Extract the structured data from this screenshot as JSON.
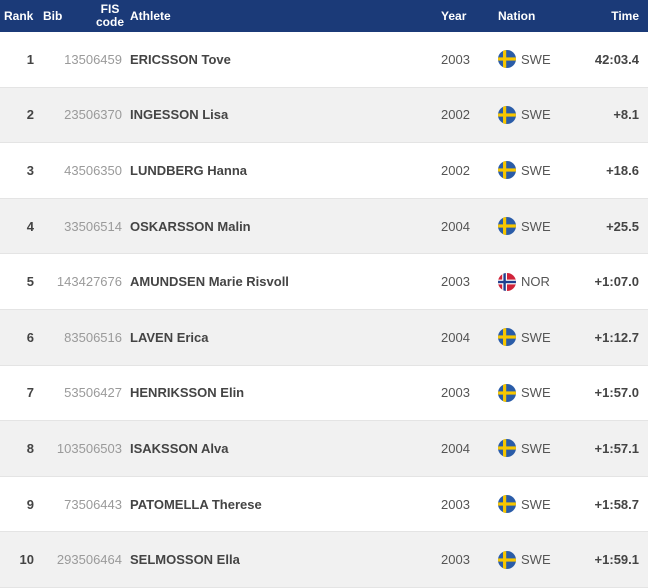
{
  "header": {
    "rank": "Rank",
    "bib": "Bib",
    "fis_line1": "FIS",
    "fis_line2": "code",
    "athlete": "Athlete",
    "year": "Year",
    "nation": "Nation",
    "time": "Time"
  },
  "colors": {
    "header_bg": "#1b3a78",
    "alt_row_bg": "#f1f1f1",
    "swe_blue": "#2a5ca8",
    "swe_yellow": "#f7c600",
    "nor_red": "#d0233a",
    "nor_blue": "#1f3f8f"
  },
  "rows": [
    {
      "rank": "1",
      "bib": "1",
      "fis": "3506459",
      "athlete": "ERICSSON Tove",
      "year": "2003",
      "flag": "swe-flag-icon",
      "nation": "SWE",
      "time": "42:03.4"
    },
    {
      "rank": "2",
      "bib": "2",
      "fis": "3506370",
      "athlete": "INGESSON Lisa",
      "year": "2002",
      "flag": "swe-flag-icon",
      "nation": "SWE",
      "time": "+8.1"
    },
    {
      "rank": "3",
      "bib": "4",
      "fis": "3506350",
      "athlete": "LUNDBERG Hanna",
      "year": "2002",
      "flag": "swe-flag-icon",
      "nation": "SWE",
      "time": "+18.6"
    },
    {
      "rank": "4",
      "bib": "3",
      "fis": "3506514",
      "athlete": "OSKARSSON Malin",
      "year": "2004",
      "flag": "swe-flag-icon",
      "nation": "SWE",
      "time": "+25.5"
    },
    {
      "rank": "5",
      "bib": "14",
      "fis": "3427676",
      "athlete": "AMUNDSEN Marie Risvoll",
      "year": "2003",
      "flag": "nor-flag-icon",
      "nation": "NOR",
      "time": "+1:07.0"
    },
    {
      "rank": "6",
      "bib": "8",
      "fis": "3506516",
      "athlete": "LAVEN Erica",
      "year": "2004",
      "flag": "swe-flag-icon",
      "nation": "SWE",
      "time": "+1:12.7"
    },
    {
      "rank": "7",
      "bib": "5",
      "fis": "3506427",
      "athlete": "HENRIKSSON Elin",
      "year": "2003",
      "flag": "swe-flag-icon",
      "nation": "SWE",
      "time": "+1:57.0"
    },
    {
      "rank": "8",
      "bib": "10",
      "fis": "3506503",
      "athlete": "ISAKSSON Alva",
      "year": "2004",
      "flag": "swe-flag-icon",
      "nation": "SWE",
      "time": "+1:57.1"
    },
    {
      "rank": "9",
      "bib": "7",
      "fis": "3506443",
      "athlete": "PATOMELLA Therese",
      "year": "2003",
      "flag": "swe-flag-icon",
      "nation": "SWE",
      "time": "+1:58.7"
    },
    {
      "rank": "10",
      "bib": "29",
      "fis": "3506464",
      "athlete": "SELMOSSON Ella",
      "year": "2003",
      "flag": "swe-flag-icon",
      "nation": "SWE",
      "time": "+1:59.1"
    }
  ]
}
